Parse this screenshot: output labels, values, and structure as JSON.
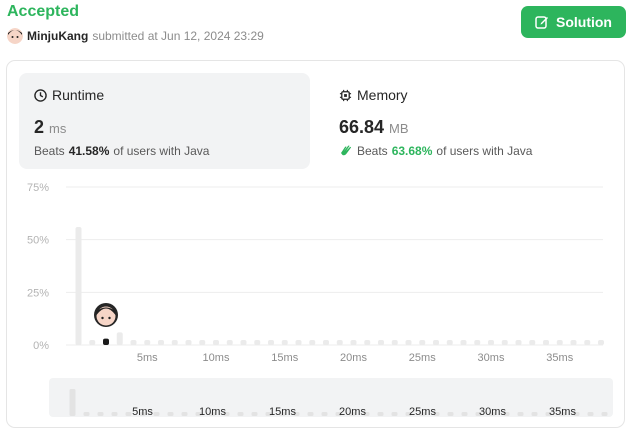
{
  "header": {
    "status": "Accepted",
    "username": "MinjuKang",
    "submitted_text": "submitted at Jun 12, 2024 23:29",
    "solution_label": "Solution"
  },
  "runtime": {
    "title": "Runtime",
    "value": "2",
    "unit": "ms",
    "beats_prefix": "Beats",
    "beats_percent": "41.58%",
    "beats_suffix": "of users with Java"
  },
  "memory": {
    "title": "Memory",
    "value": "66.84",
    "unit": "MB",
    "beats_prefix": "Beats",
    "beats_percent": "63.68%",
    "beats_suffix": "of users with Java"
  },
  "colors": {
    "accent": "#2db55d",
    "card_bg": "#f2f3f4",
    "bar": "#ebebeb",
    "user_bar": "#1a1a1a"
  },
  "chart_data": {
    "type": "bar",
    "title": "",
    "xlabel": "",
    "ylabel": "",
    "ylim": [
      0,
      75
    ],
    "yticks": [
      "0%",
      "25%",
      "50%",
      "75%"
    ],
    "xticks": [
      "5ms",
      "10ms",
      "15ms",
      "20ms",
      "25ms",
      "30ms",
      "35ms"
    ],
    "categories": [
      "0ms",
      "1ms",
      "2ms",
      "3ms",
      "4ms",
      "5ms",
      "6ms",
      "7ms",
      "8ms",
      "9ms",
      "10ms",
      "11ms",
      "12ms",
      "13ms",
      "14ms",
      "15ms",
      "16ms",
      "17ms",
      "18ms",
      "19ms",
      "20ms",
      "21ms",
      "22ms",
      "23ms",
      "24ms",
      "25ms",
      "26ms",
      "27ms",
      "28ms",
      "29ms",
      "30ms",
      "31ms",
      "32ms",
      "33ms",
      "34ms",
      "35ms",
      "36ms",
      "37ms",
      "38ms"
    ],
    "values": [
      56,
      1,
      3,
      6,
      1,
      1,
      1,
      1,
      1,
      1,
      1,
      1,
      1,
      1,
      1,
      1,
      1,
      1,
      1,
      1,
      1,
      1,
      1,
      1,
      1,
      1,
      1,
      1,
      1,
      1,
      1,
      1,
      1,
      1,
      1,
      1,
      1,
      1,
      1
    ],
    "highlight_index": 2,
    "grid": true,
    "overview_xticks": [
      "5ms",
      "10ms",
      "15ms",
      "20ms",
      "25ms",
      "30ms",
      "35ms"
    ]
  }
}
